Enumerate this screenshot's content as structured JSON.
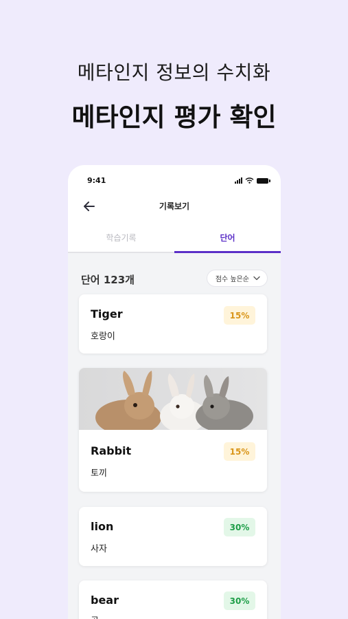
{
  "promo": {
    "subtitle": "메타인지 정보의 수치화",
    "title": "메타인지 평가 확인"
  },
  "status_bar": {
    "time": "9:41"
  },
  "nav": {
    "title": "기록보기"
  },
  "tabs": [
    {
      "label": "학습기록",
      "active": false
    },
    {
      "label": "단어",
      "active": true
    }
  ],
  "list": {
    "count_label": "단어 123개",
    "sort_label": "점수 높은순"
  },
  "words": [
    {
      "word": "Tiger",
      "meaning": "호랑이",
      "score": "15%"
    },
    {
      "word": "Rabbit",
      "meaning": "토끼",
      "score": "15%"
    },
    {
      "word": "lion",
      "meaning": "사자",
      "score": "30%"
    },
    {
      "word": "bear",
      "meaning": "곰",
      "score": "30%"
    }
  ],
  "colors": {
    "background": "#efebfc",
    "accent": "#5b2fc7",
    "badge_low_bg": "#fff4da",
    "badge_low_text": "#d9951a",
    "badge_mid_bg": "#e3f7e8",
    "badge_mid_text": "#1e9e48"
  },
  "icons": [
    "back-arrow-icon",
    "signal-icon",
    "wifi-icon",
    "battery-icon",
    "chevron-down-icon"
  ]
}
